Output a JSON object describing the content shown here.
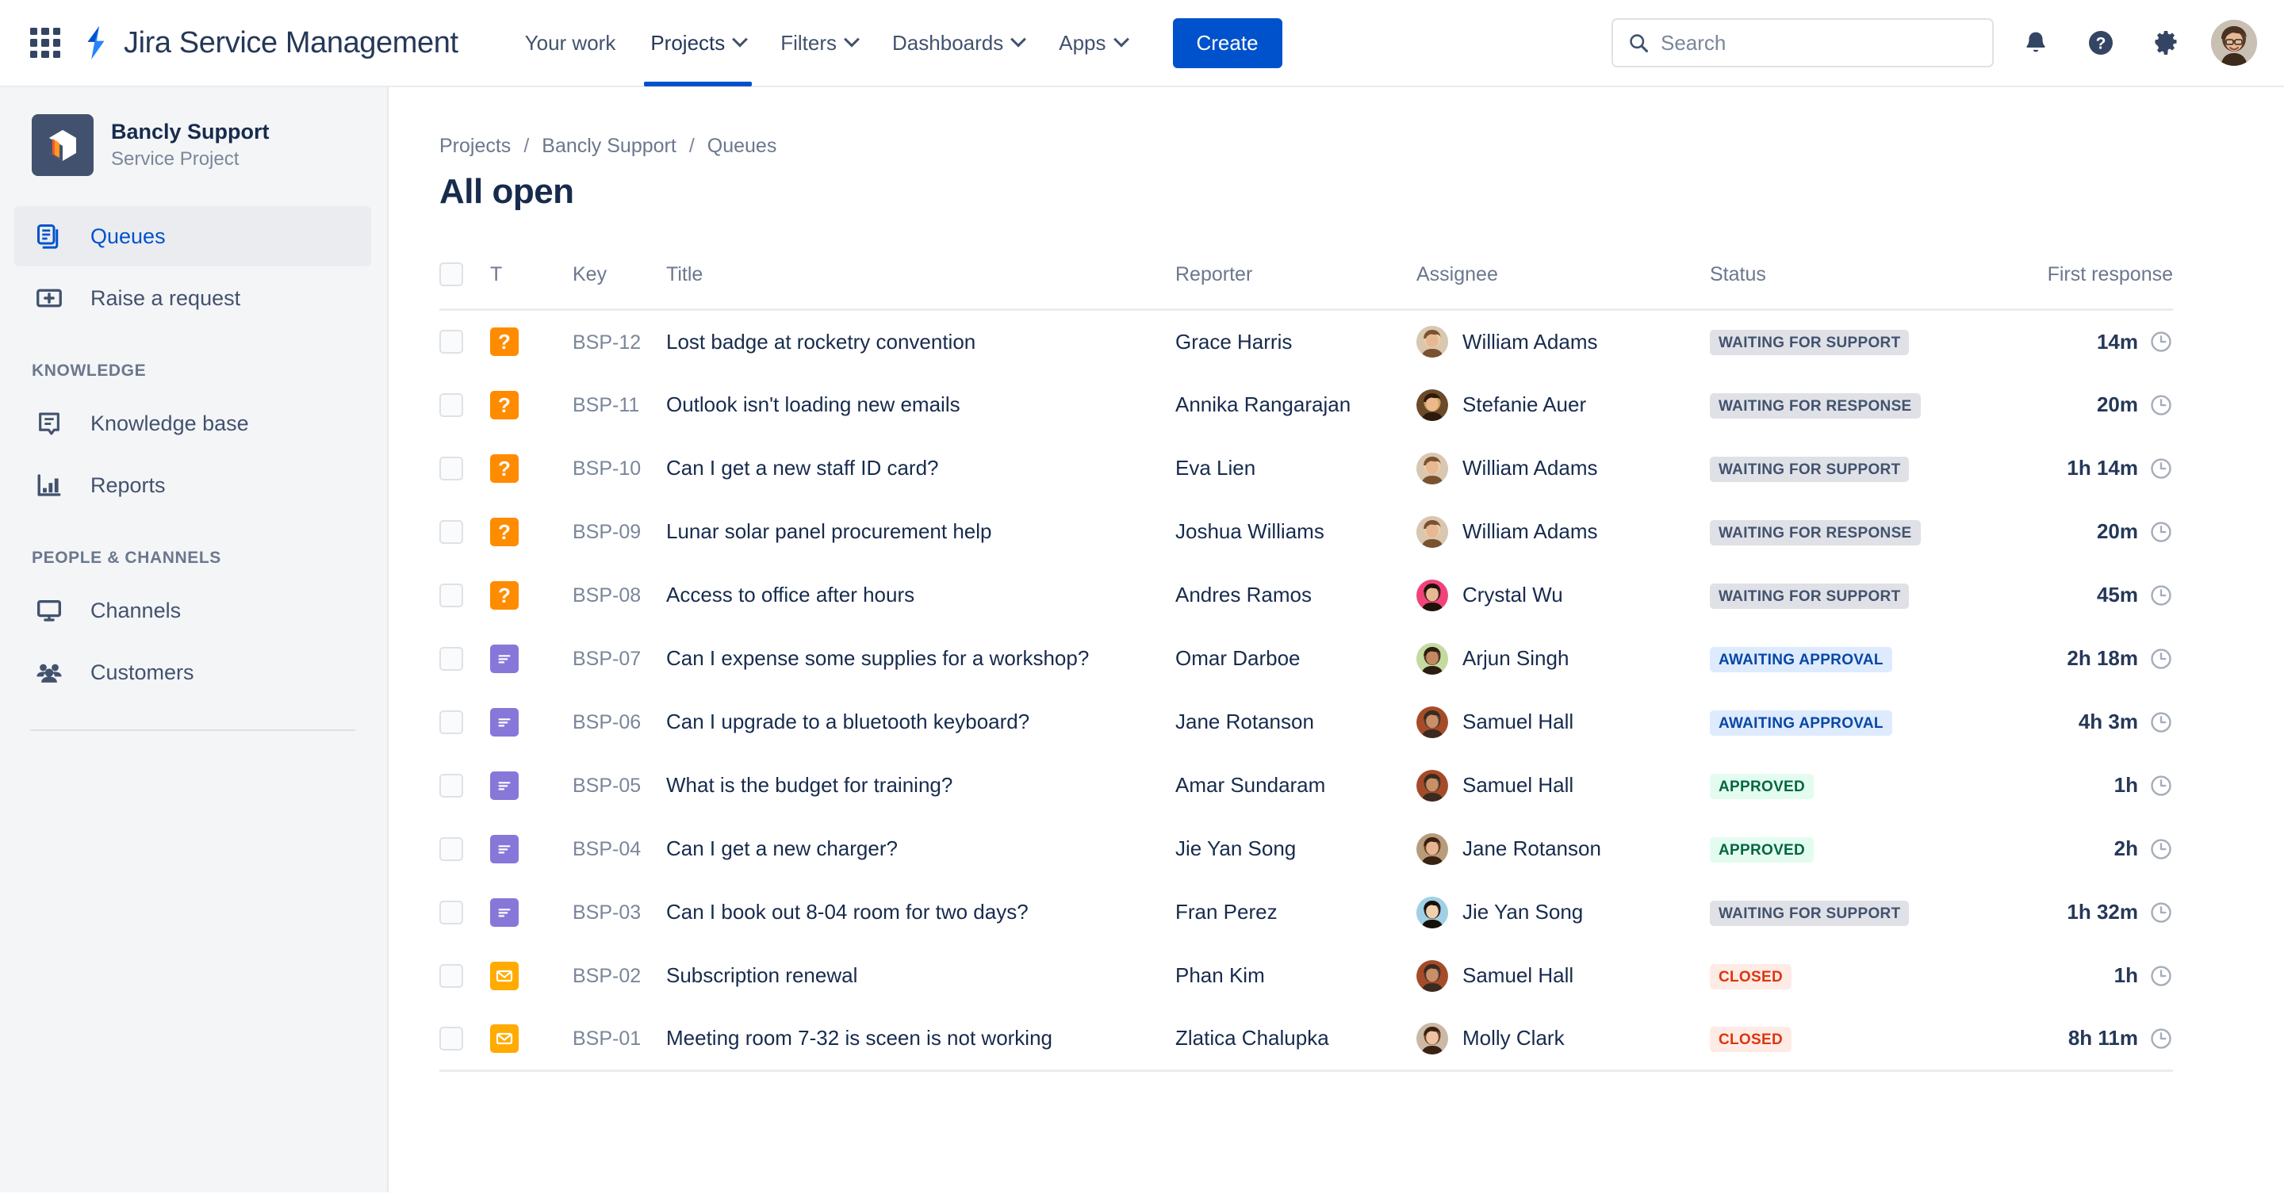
{
  "topnav": {
    "apps_icon": "apps-grid-icon",
    "product_logo_icon": "jira-logo-icon",
    "product_name": "Jira Service Management",
    "items": [
      {
        "label": "Your work",
        "has_chevron": false,
        "active": false
      },
      {
        "label": "Projects",
        "has_chevron": true,
        "active": true
      },
      {
        "label": "Filters",
        "has_chevron": true,
        "active": false
      },
      {
        "label": "Dashboards",
        "has_chevron": true,
        "active": false
      },
      {
        "label": "Apps",
        "has_chevron": true,
        "active": false
      }
    ],
    "create_label": "Create",
    "search": {
      "value": "",
      "placeholder": "Search",
      "icon": "search-icon"
    },
    "notifications_icon": "bell-icon",
    "help_icon": "help-circle-icon",
    "settings_icon": "gear-icon",
    "account_avatar": "user-avatar"
  },
  "sidebar": {
    "project": {
      "name": "Bancly Support",
      "type": "Service Project",
      "avatar_icon": "project-avatar-icon"
    },
    "items": [
      {
        "label": "Queues",
        "icon": "queues-icon",
        "selected": true
      },
      {
        "label": "Raise a request",
        "icon": "raise-request-icon",
        "selected": false
      }
    ],
    "sections": [
      {
        "title": "KNOWLEDGE",
        "items": [
          {
            "label": "Knowledge base",
            "icon": "knowledge-base-icon",
            "selected": false
          },
          {
            "label": "Reports",
            "icon": "reports-icon",
            "selected": false
          }
        ]
      },
      {
        "title": "PEOPLE & CHANNELS",
        "items": [
          {
            "label": "Channels",
            "icon": "channels-icon",
            "selected": false
          },
          {
            "label": "Customers",
            "icon": "customers-icon",
            "selected": false
          }
        ]
      }
    ]
  },
  "main": {
    "breadcrumb": [
      "Projects",
      "Bancly Support",
      "Queues"
    ],
    "breadcrumb_separator": "/",
    "page_title": "All open",
    "table": {
      "columns": [
        {
          "key": "check",
          "label": ""
        },
        {
          "key": "type",
          "label": "T"
        },
        {
          "key": "key",
          "label": "Key"
        },
        {
          "key": "title",
          "label": "Title"
        },
        {
          "key": "reporter",
          "label": "Reporter"
        },
        {
          "key": "assignee",
          "label": "Assignee"
        },
        {
          "key": "status",
          "label": "Status"
        },
        {
          "key": "first_response",
          "label": "First response"
        }
      ],
      "rows": [
        {
          "type": "question",
          "key": "BSP-12",
          "title": "Lost badge at rocketry convention",
          "reporter": "Grace Harris",
          "assignee": "William Adams",
          "avatar": "avatar-william",
          "status": "WAITING FOR SUPPORT",
          "status_tone": "default",
          "first_response": "14m"
        },
        {
          "type": "question",
          "key": "BSP-11",
          "title": "Outlook isn't loading new emails",
          "reporter": "Annika Rangarajan",
          "assignee": "Stefanie Auer",
          "avatar": "avatar-stefanie",
          "status": "WAITING FOR RESPONSE",
          "status_tone": "default",
          "first_response": "20m"
        },
        {
          "type": "question",
          "key": "BSP-10",
          "title": "Can I get a new staff ID card?",
          "reporter": "Eva Lien",
          "assignee": "William Adams",
          "avatar": "avatar-william",
          "status": "WAITING FOR SUPPORT",
          "status_tone": "default",
          "first_response": "1h 14m"
        },
        {
          "type": "question",
          "key": "BSP-09",
          "title": "Lunar solar panel procurement help",
          "reporter": "Joshua Williams",
          "assignee": "William Adams",
          "avatar": "avatar-william",
          "status": "WAITING FOR RESPONSE",
          "status_tone": "default",
          "first_response": "20m"
        },
        {
          "type": "question",
          "key": "BSP-08",
          "title": "Access to office after hours",
          "reporter": "Andres Ramos",
          "assignee": "Crystal Wu",
          "avatar": "avatar-crystal",
          "status": "WAITING FOR SUPPORT",
          "status_tone": "default",
          "first_response": "45m"
        },
        {
          "type": "task",
          "key": "BSP-07",
          "title": "Can I expense some supplies for a workshop?",
          "reporter": "Omar Darboe",
          "assignee": "Arjun Singh",
          "avatar": "avatar-arjun",
          "status": "AWAITING APPROVAL",
          "status_tone": "inprogress",
          "first_response": "2h 18m"
        },
        {
          "type": "task",
          "key": "BSP-06",
          "title": "Can I upgrade to a bluetooth keyboard?",
          "reporter": "Jane Rotanson",
          "assignee": "Samuel Hall",
          "avatar": "avatar-samuel",
          "status": "AWAITING APPROVAL",
          "status_tone": "inprogress",
          "first_response": "4h 3m"
        },
        {
          "type": "task",
          "key": "BSP-05",
          "title": "What is the budget for training?",
          "reporter": "Amar Sundaram",
          "assignee": "Samuel Hall",
          "avatar": "avatar-samuel",
          "status": "APPROVED",
          "status_tone": "success",
          "first_response": "1h"
        },
        {
          "type": "task",
          "key": "BSP-04",
          "title": "Can I get a new charger?",
          "reporter": "Jie Yan Song",
          "assignee": "Jane Rotanson",
          "avatar": "avatar-jane",
          "status": "APPROVED",
          "status_tone": "success",
          "first_response": "2h"
        },
        {
          "type": "task",
          "key": "BSP-03",
          "title": "Can I book out 8-04 room for two days?",
          "reporter": "Fran Perez",
          "assignee": "Jie Yan Song",
          "avatar": "avatar-jieyan",
          "status": "WAITING FOR SUPPORT",
          "status_tone": "default",
          "first_response": "1h 32m"
        },
        {
          "type": "email",
          "key": "BSP-02",
          "title": "Subscription renewal",
          "reporter": "Phan Kim",
          "assignee": "Samuel Hall",
          "avatar": "avatar-samuel",
          "status": "CLOSED",
          "status_tone": "removed",
          "first_response": "1h"
        },
        {
          "type": "email",
          "key": "BSP-01",
          "title": "Meeting room 7-32 is sceen is not working",
          "reporter": "Zlatica Chalupka",
          "assignee": "Molly Clark",
          "avatar": "avatar-molly",
          "status": "CLOSED",
          "status_tone": "removed",
          "first_response": "8h 11m"
        }
      ]
    }
  },
  "colors": {
    "brand_blue": "#0052cc",
    "text_primary": "#172b4d",
    "text_subtle": "#6b778c",
    "type_question": "#ff8b00",
    "type_task": "#8777d9",
    "type_email": "#ffab00",
    "lozenge_default_bg": "#dfe1e6",
    "lozenge_inprogress_bg": "#deebff",
    "lozenge_success_bg": "#e3fcef",
    "lozenge_removed_bg": "#ffebe6"
  }
}
